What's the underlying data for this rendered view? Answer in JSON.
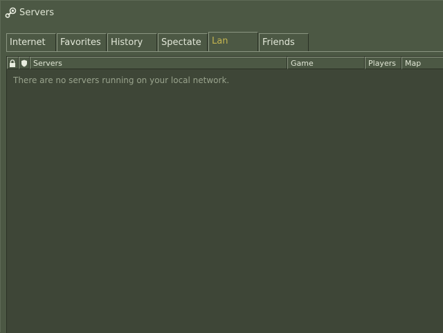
{
  "window": {
    "title": "Servers",
    "logo_icon": "steam-logo-icon"
  },
  "tabs": [
    {
      "label": "Internet",
      "active": false
    },
    {
      "label": "Favorites",
      "active": false
    },
    {
      "label": "History",
      "active": false
    },
    {
      "label": "Spectate",
      "active": false
    },
    {
      "label": "Lan",
      "active": true
    },
    {
      "label": "Friends",
      "active": false
    }
  ],
  "list": {
    "columns": {
      "lock_icon": "lock-icon",
      "secure_icon": "shield-icon",
      "servers": "Servers",
      "game": "Game",
      "players": "Players",
      "map": "Map"
    },
    "empty_message": "There are no servers running on your local network."
  },
  "colors": {
    "window_bg": "#4c5844",
    "list_bg": "#3e4637",
    "active_tab_text": "#c4b550",
    "text": "#dfe5d4",
    "muted_text": "#99a38d"
  }
}
